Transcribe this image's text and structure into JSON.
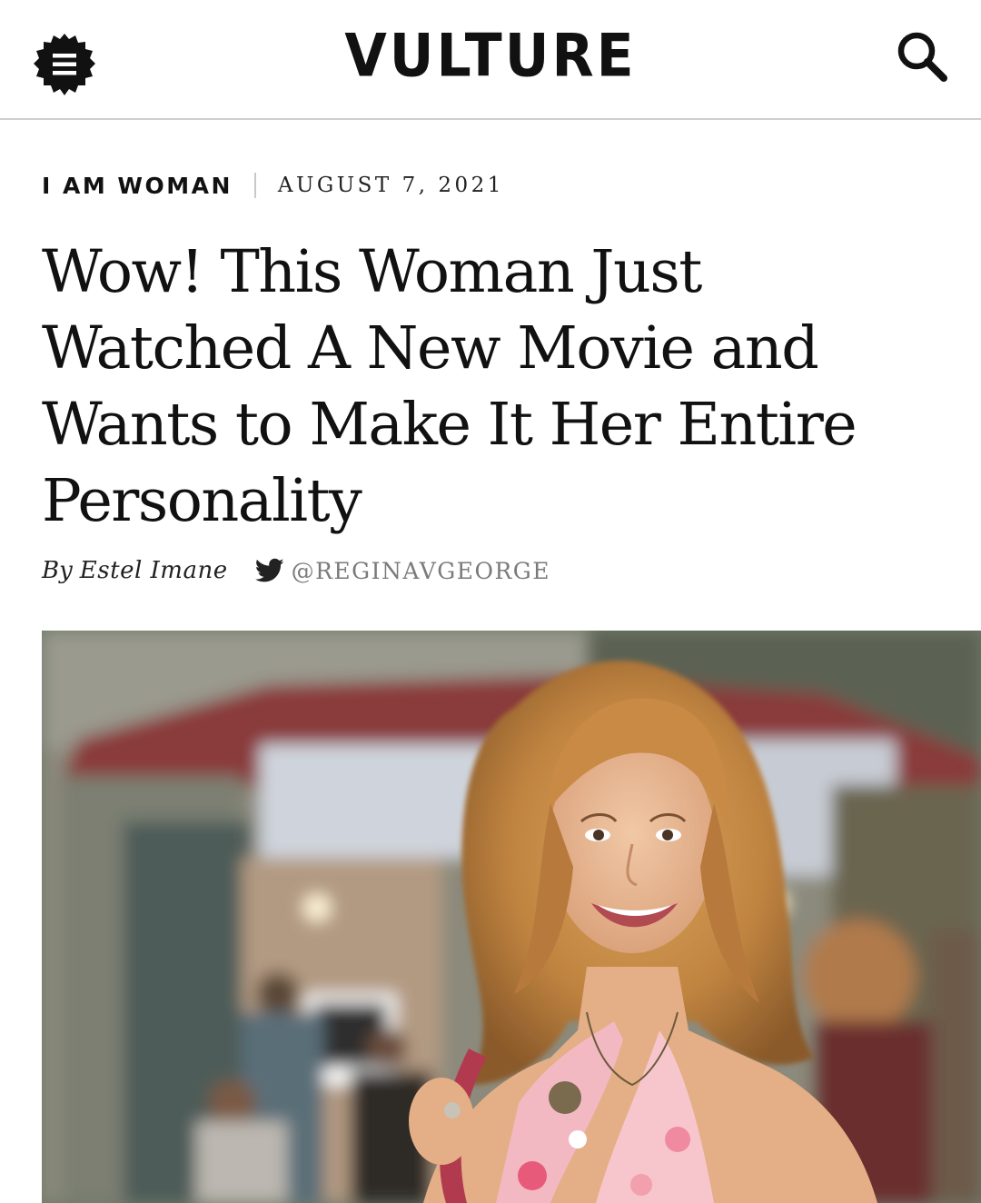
{
  "header": {
    "logo_text": "VULTURE",
    "menu_icon": "hamburger-menu-icon",
    "search_icon": "search-icon"
  },
  "article": {
    "rubric": "I AM WOMAN",
    "date": "AUGUST 7, 2021",
    "headline": "Wow! This Woman Just Watched A New Movie and Wants to Make It Her Entire Personality",
    "byline": {
      "prefix": "By",
      "author": "Estel Imane",
      "twitter_icon": "twitter-bird-icon",
      "twitter_handle": "@REGINAVGEORGE"
    },
    "lead_image": {
      "kind": "photo"
    }
  },
  "colors": {
    "text": "#111111",
    "divider": "#cfcfcf",
    "handle_gray": "#7a7a7a"
  }
}
